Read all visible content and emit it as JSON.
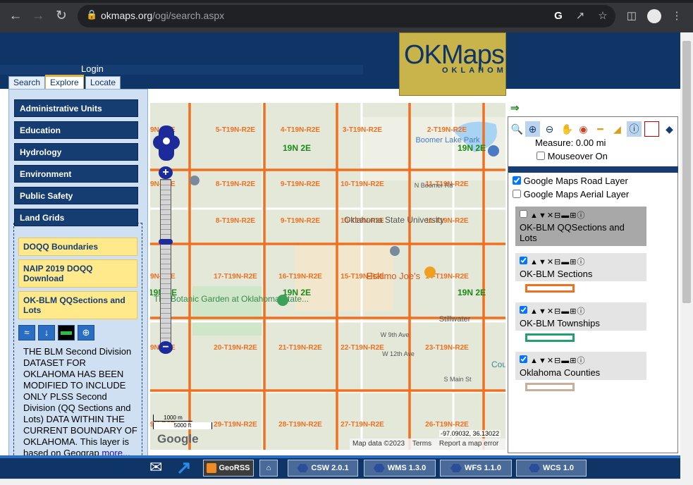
{
  "browser": {
    "url_domain": "okmaps.org",
    "url_path": "/ogi/search.aspx"
  },
  "header": {
    "login": "Login",
    "logo_text": "OKMaps",
    "logo_sub": "OKLAHOMA"
  },
  "tabs": [
    "Search",
    "Explore",
    "Locate"
  ],
  "sidebar": {
    "categories": [
      "Administrative Units",
      "Education",
      "Hydrology",
      "Environment",
      "Public Safety",
      "Land Grids"
    ],
    "layers": [
      "DOQQ Boundaries",
      "NAIP 2019 DOQQ Download",
      "OK-BLM QQSections and Lots"
    ],
    "description": "THE BLM Second Division DATASET FOR OKLAHOMA HAS BEEN MODIFIED TO INCLUDE ONLY PLSS Second Division (QQ Sections and Lots) DATA WITHIN THE CURRENT BOUNDARY OF OKLAHOMA. This layer is based on Geograp",
    "more": "more..."
  },
  "map": {
    "grid_labels": [
      "5-T19N-R2E",
      "4-T19N-R2E",
      "3-T19N-R2E",
      "2-T19N-R2E",
      "8-T19N-R2E",
      "9-T19N-R2E",
      "10-T19N-R2E",
      "11-T19N-R2E",
      "8-T19N-R2E",
      "9-T19N-R2E",
      "10-T19N-R2E",
      "11-T19N-R2E",
      "17-T19N-R2E",
      "16-T19N-R2E",
      "15-T19N-R2E",
      "14-T19N-R2E",
      "20-T19N-R2E",
      "21-T19N-R2E",
      "22-T19N-R2E",
      "23-T19N-R2E",
      "29-T19N-R2E",
      "28-T19N-R2E",
      "27-T19N-R2E",
      "26-T19N-R2E"
    ],
    "edge_labels": [
      "9N-R2E",
      "9N-R2E",
      "9N-R2E",
      "9N-R2E",
      "9N-R2E"
    ],
    "township_labels": [
      "19N 2E",
      "19N 2E",
      "19N 2E",
      "19N 2E",
      "19N 2E"
    ],
    "places": [
      "Boomer Lake Park",
      "Oklahoma State University",
      "Eskimo Joe's",
      "The Botanic Garden at Oklahoma State...",
      "Stillwater",
      "W 9th Ave",
      "W 12th Ave",
      "N Boomer Rd",
      "S Main St",
      "Cou"
    ],
    "scale_m": "1000 m",
    "scale_ft": "5000 ft",
    "google": "Google",
    "attribution": "Map data ©2023",
    "terms": "Terms",
    "report": "Report a map error",
    "coords": "-97.09032, 36.13022"
  },
  "right_panel": {
    "measure": "Measure: 0.00 mi",
    "mouseover": "Mouseover On",
    "road_layer": "Google Maps Road Layer",
    "aerial_layer": "Google Maps Aerial Layer",
    "layers": [
      {
        "name": "OK-BLM QQSections and Lots",
        "checked": false
      },
      {
        "name": "OK-BLM Sections",
        "checked": true,
        "color": "#f07020"
      },
      {
        "name": "OK-BLM Townships",
        "checked": true,
        "color": "#20a070"
      },
      {
        "name": "Oklahoma Counties",
        "checked": true,
        "color": "#c8b098"
      }
    ]
  },
  "footer": {
    "georss": "GeoRSS",
    "csw": "CSW 2.0.1",
    "wms": "WMS 1.3.0",
    "wfs": "WFS 1.1.0",
    "wcs": "WCS 1.0"
  },
  "colors": {
    "navy": "#0f3466",
    "section_line": "#f07020",
    "township_label": "#1a8a1a",
    "layer_yellow": "#ffe98a"
  }
}
